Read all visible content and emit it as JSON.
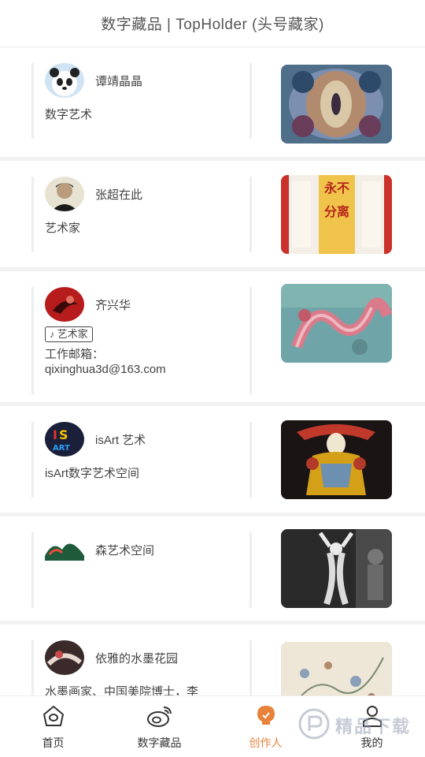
{
  "header": {
    "title": "数字藏品 | TopHolder (头号藏家)"
  },
  "creators": [
    {
      "name": "谭靖晶晶",
      "description": "数字艺术",
      "avatar_icon": "panda-avatar-icon",
      "artwork": "kaleidoscope-artwork"
    },
    {
      "name": "张超在此",
      "description": "艺术家",
      "avatar_icon": "portrait-avatar-icon",
      "artwork": "banner-calligraphy-artwork"
    },
    {
      "name": "齐兴华",
      "tag": "艺术家",
      "email_label": "工作邮箱：",
      "email": "qixinghua3d@163.com",
      "avatar_icon": "red-ink-avatar-icon",
      "artwork": "dragon-mural-artwork"
    },
    {
      "name": "isArt 艺术",
      "description": "isArt数字艺术空间",
      "avatar_icon": "isart-logo-icon",
      "artwork": "opera-warrior-artwork"
    },
    {
      "name": "森艺术空间",
      "description": "",
      "avatar_icon": "landscape-avatar-icon",
      "artwork": "dancer-collage-artwork"
    },
    {
      "name": "依雅的水墨花园",
      "description": "水墨画家、中国美院博士，李",
      "avatar_icon": "ink-avatar-icon",
      "artwork": "ink-floral-artwork"
    }
  ],
  "tabbar": {
    "tabs": [
      {
        "label": "首页",
        "icon": "home-icon"
      },
      {
        "label": "数字藏品",
        "icon": "weibo-icon"
      },
      {
        "label": "创作人",
        "icon": "creator-bulb-icon",
        "active": true
      },
      {
        "label": "我的",
        "icon": "profile-icon"
      }
    ]
  },
  "watermark": {
    "text": "精品下载"
  },
  "colors": {
    "accent": "#e8823a",
    "divider": "#f2f2f2"
  }
}
